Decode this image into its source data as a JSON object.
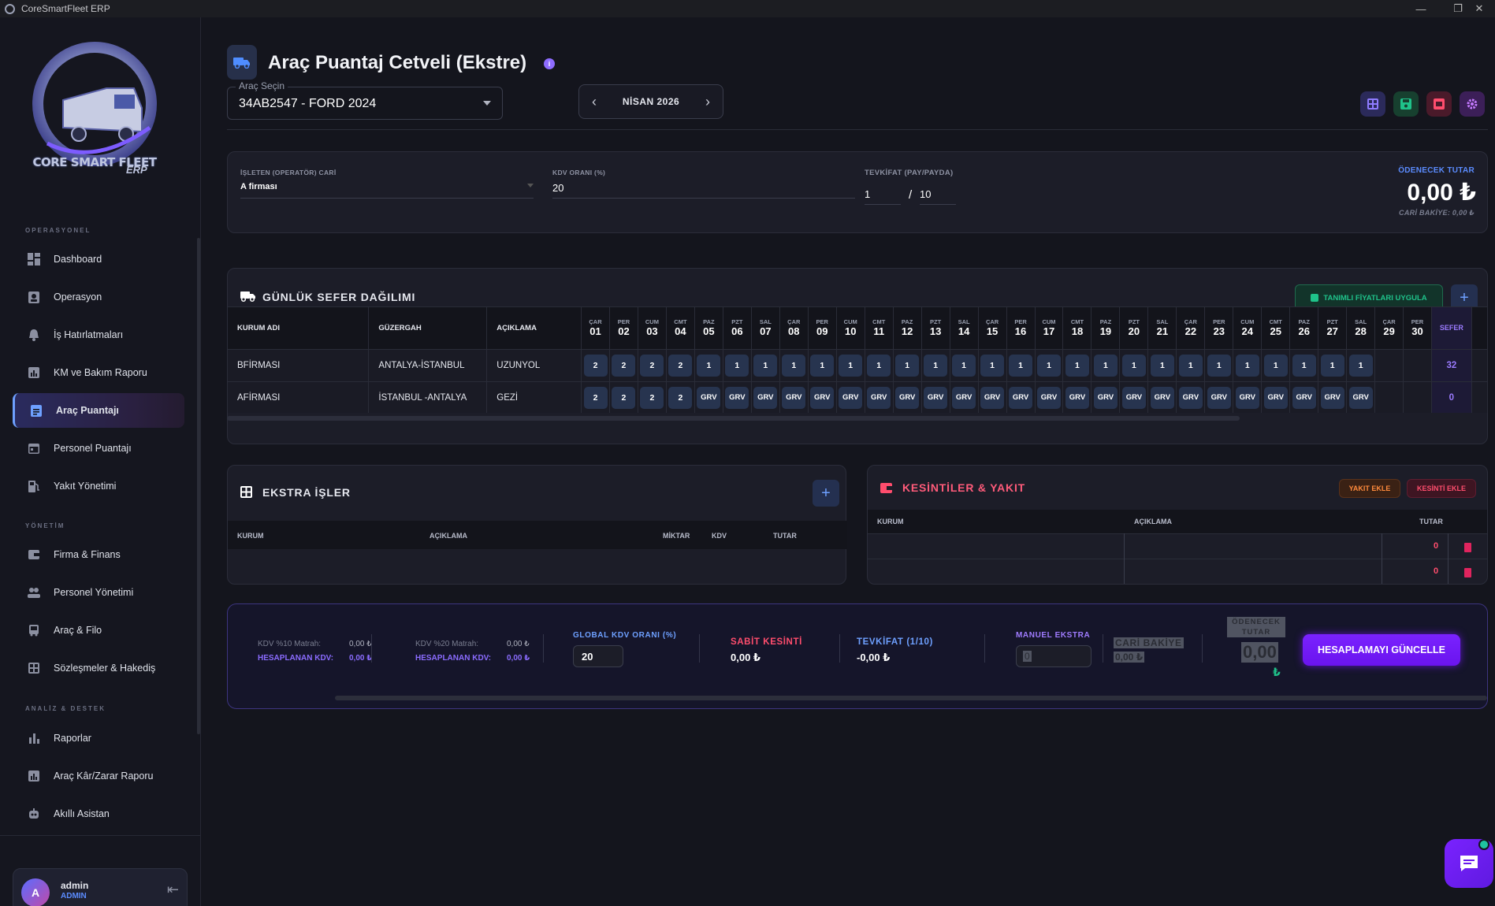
{
  "window": {
    "title": "CoreSmartFleet ERP"
  },
  "logo": {
    "text": "CORE SMART FLEET",
    "sub": "ERP"
  },
  "sidebar": {
    "sections": [
      "OPERASYONEL",
      "YÖNETİM",
      "ANALİZ & DESTEK"
    ],
    "items": [
      "Dashboard",
      "Operasyon",
      "İş Hatırlatmaları",
      "KM ve Bakım Raporu",
      "Araç Puantajı",
      "Personel Puantajı",
      "Yakıt Yönetimi",
      "Firma & Finans",
      "Personel Yönetimi",
      "Araç & Filo",
      "Sözleşmeler & Hakediş",
      "Raporlar",
      "Araç Kâr/Zarar Raporu",
      "Akıllı Asistan"
    ]
  },
  "user": {
    "initial": "A",
    "name": "admin",
    "role": "ADMIN"
  },
  "page": {
    "title": "Araç Puantaj Cetveli (Ekstre)",
    "info": "i"
  },
  "vehicle_select": {
    "label": "Araç Seçin",
    "value": "34AB2547 - FORD 2024"
  },
  "month": {
    "label": "NİSAN 2026",
    "prev": "‹",
    "next": "›"
  },
  "top_form": {
    "operator_label": "İŞLETEN (OPERATÖR) CARİ",
    "operator_value": "A firması",
    "kdv_label": "KDV ORANI (%)",
    "kdv_value": "20",
    "tevkifat_label": "TEVKİFAT (PAY/PAYDA)",
    "tevkifat_pay": "1",
    "tevkifat_sep": "/",
    "tevkifat_payda": "10",
    "odenecek_label": "ÖDENECEK TUTAR",
    "odenecek_value": "0,00 ₺",
    "cari_bakiye": "CARİ BAKİYE: 0,00 ₺"
  },
  "daily": {
    "title": "GÜNLÜK SEFER DAĞILIMI",
    "apply_btn": "TANIMLI FİYATLARI UYGULA",
    "add_btn": "+",
    "headers": {
      "kurum": "KURUM ADI",
      "guzergah": "GÜZERGAH",
      "aciklama": "AÇIKLAMA",
      "sefer": "SEFER"
    },
    "days": [
      {
        "n": "ÇAR",
        "d": "01"
      },
      {
        "n": "PER",
        "d": "02"
      },
      {
        "n": "CUM",
        "d": "03"
      },
      {
        "n": "CMT",
        "d": "04"
      },
      {
        "n": "PAZ",
        "d": "05"
      },
      {
        "n": "PZT",
        "d": "06"
      },
      {
        "n": "SAL",
        "d": "07"
      },
      {
        "n": "ÇAR",
        "d": "08"
      },
      {
        "n": "PER",
        "d": "09"
      },
      {
        "n": "CUM",
        "d": "10"
      },
      {
        "n": "CMT",
        "d": "11"
      },
      {
        "n": "PAZ",
        "d": "12"
      },
      {
        "n": "PZT",
        "d": "13"
      },
      {
        "n": "SAL",
        "d": "14"
      },
      {
        "n": "ÇAR",
        "d": "15"
      },
      {
        "n": "PER",
        "d": "16"
      },
      {
        "n": "CUM",
        "d": "17"
      },
      {
        "n": "CMT",
        "d": "18"
      },
      {
        "n": "PAZ",
        "d": "19"
      },
      {
        "n": "PZT",
        "d": "20"
      },
      {
        "n": "SAL",
        "d": "21"
      },
      {
        "n": "ÇAR",
        "d": "22"
      },
      {
        "n": "PER",
        "d": "23"
      },
      {
        "n": "CUM",
        "d": "24"
      },
      {
        "n": "CMT",
        "d": "25"
      },
      {
        "n": "PAZ",
        "d": "26"
      },
      {
        "n": "PZT",
        "d": "27"
      },
      {
        "n": "SAL",
        "d": "28"
      },
      {
        "n": "ÇAR",
        "d": "29"
      },
      {
        "n": "PER",
        "d": "30"
      }
    ],
    "rows": [
      {
        "kurum": "BFİRMASI",
        "guzergah": "ANTALYA-İSTANBUL",
        "aciklama": "UZUNYOL",
        "cells": [
          "2",
          "2",
          "2",
          "2",
          "1",
          "1",
          "1",
          "1",
          "1",
          "1",
          "1",
          "1",
          "1",
          "1",
          "1",
          "1",
          "1",
          "1",
          "1",
          "1",
          "1",
          "1",
          "1",
          "1",
          "1",
          "1",
          "1",
          "1",
          "",
          ""
        ],
        "sefer": "32"
      },
      {
        "kurum": "AFİRMASI",
        "guzergah": "İSTANBUL -ANTALYA",
        "aciklama": "GEZİ",
        "cells": [
          "2",
          "2",
          "2",
          "2",
          "GRV",
          "GRV",
          "GRV",
          "GRV",
          "GRV",
          "GRV",
          "GRV",
          "GRV",
          "GRV",
          "GRV",
          "GRV",
          "GRV",
          "GRV",
          "GRV",
          "GRV",
          "GRV",
          "GRV",
          "GRV",
          "GRV",
          "GRV",
          "GRV",
          "GRV",
          "GRV",
          "GRV",
          "",
          ""
        ],
        "sefer": "0"
      }
    ]
  },
  "extra": {
    "title": "EKSTRA İŞLER",
    "add_btn": "+",
    "headers": [
      "KURUM",
      "AÇIKLAMA",
      "MİKTAR",
      "KDV",
      "TUTAR"
    ]
  },
  "kesinti": {
    "title": "KESİNTİLER & YAKIT",
    "yakit_btn": "YAKIT EKLE",
    "kesinti_btn": "KESİNTİ EKLE",
    "headers": [
      "KURUM",
      "AÇIKLAMA",
      "TUTAR"
    ],
    "rows": [
      {
        "tutar": "0"
      },
      {
        "tutar": "0"
      }
    ]
  },
  "summary": {
    "kdv10_matrah_label": "KDV %10 Matrah:",
    "kdv10_matrah": "0,00 ₺",
    "kdv10_hesap_label": "HESAPLANAN KDV:",
    "kdv10_hesap": "0,00 ₺",
    "kdv20_matrah_label": "KDV %20 Matrah:",
    "kdv20_matrah": "0,00 ₺",
    "kdv20_hesap_label": "HESAPLANAN KDV:",
    "kdv20_hesap": "0,00 ₺",
    "global_kdv_label": "GLOBAL KDV ORANI (%)",
    "global_kdv": "20",
    "sabit_label": "SABİT KESİNTİ",
    "sabit": "0,00 ₺",
    "tevkifat_label": "TEVKİFAT (1/10)",
    "tevkifat": "-0,00 ₺",
    "manuel_label": "MANUEL EKSTRA",
    "manuel": "0",
    "cari_label": "CARİ BAKİYE",
    "cari": "0,00 ₺",
    "odenecek_label1": "ÖDENECEK",
    "odenecek_label2": "TUTAR",
    "odenecek": "0,00",
    "currency": "₺",
    "update_btn": "HESAPLAMAYI GÜNCELLE"
  },
  "colors": {
    "accent": "#7a22ff",
    "blue": "#5b8cff",
    "red": "#ff4d6d",
    "green": "#1fc28a",
    "bg": "#14151d"
  }
}
